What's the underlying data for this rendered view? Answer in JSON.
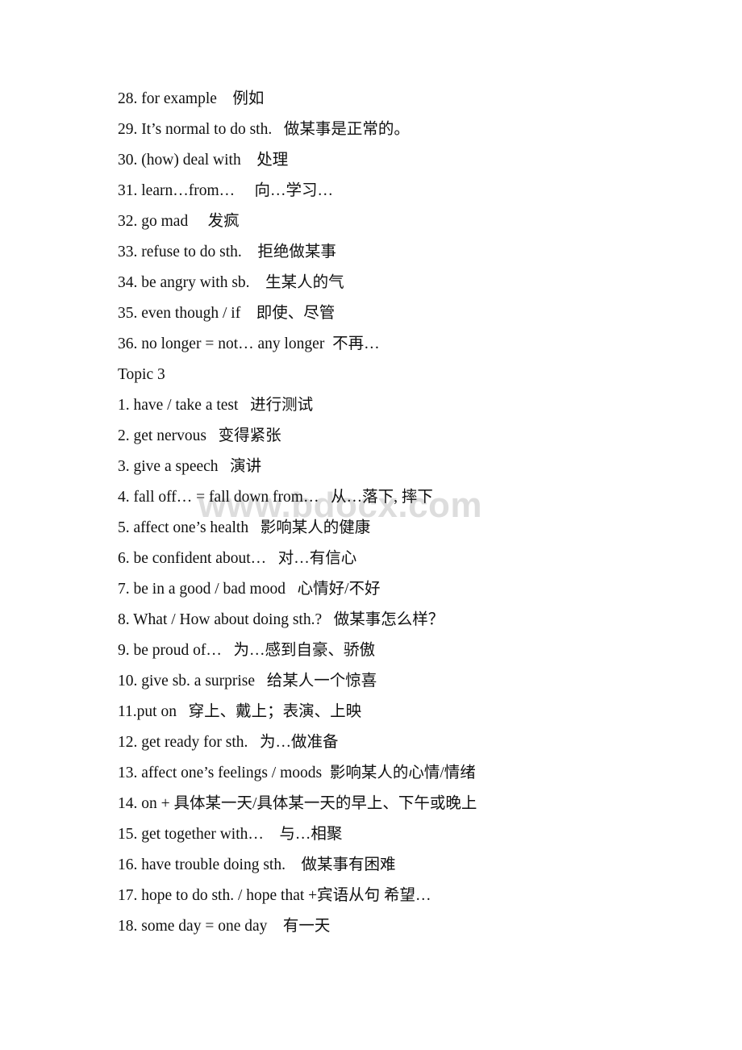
{
  "page": {
    "background_color": "#ffffff",
    "text_color": "#101010",
    "watermark": {
      "text": "www.bdocx.com",
      "color": "#dddddd"
    }
  },
  "blocks": [
    {
      "type": "list",
      "name": "topic-2-continued",
      "items": [
        {
          "num": "28.",
          "en": "for example",
          "gap": "    ",
          "cn": "例如"
        },
        {
          "num": "29.",
          "en": "It’s normal to do sth.",
          "gap": "   ",
          "cn": "做某事是正常的。"
        },
        {
          "num": "30.",
          "en": "(how) deal with",
          "gap": "    ",
          "cn": "处理"
        },
        {
          "num": "31.",
          "en": "learn…from…",
          "gap": "     ",
          "cn": "向…学习…"
        },
        {
          "num": "32.",
          "en": "go mad",
          "gap": "     ",
          "cn": "发疯"
        },
        {
          "num": "33.",
          "en": "refuse to do sth.",
          "gap": "    ",
          "cn": "拒绝做某事"
        },
        {
          "num": "34.",
          "en": "be angry with sb.",
          "gap": "    ",
          "cn": "生某人的气"
        },
        {
          "num": "35.",
          "en": "even though / if",
          "gap": "    ",
          "cn": "即使、尽管"
        },
        {
          "num": "36.",
          "en": "no longer = not… any longer",
          "gap": "  ",
          "cn": "不再…"
        }
      ]
    },
    {
      "type": "heading",
      "name": "topic-3-heading",
      "text": "Topic 3"
    },
    {
      "type": "list",
      "name": "topic-3-list",
      "items": [
        {
          "num": "1.",
          "en": "have / take a test",
          "gap": "   ",
          "cn": "进行测试"
        },
        {
          "num": "2.",
          "en": "get nervous",
          "gap": "   ",
          "cn": "变得紧张"
        },
        {
          "num": "3.",
          "en": "give a speech",
          "gap": "   ",
          "cn": "演讲"
        },
        {
          "num": "4.",
          "en": "fall off… = fall down from…",
          "gap": "   ",
          "cn": "从…落下, 摔下"
        },
        {
          "num": "5.",
          "en": "affect one’s health",
          "gap": "   ",
          "cn": "影响某人的健康"
        },
        {
          "num": "6.",
          "en": "be confident about…",
          "gap": "   ",
          "cn": "对…有信心"
        },
        {
          "num": "7.",
          "en": "be in a good / bad mood",
          "gap": "   ",
          "cn": "心情好/不好"
        },
        {
          "num": "8.",
          "en": "What / How about doing sth.?",
          "gap": "   ",
          "cn": "做某事怎么样？"
        },
        {
          "num": "9.",
          "en": "be proud of…",
          "gap": "   ",
          "cn": "为…感到自豪、骄傲"
        },
        {
          "num": "10.",
          "en": "give sb. a surprise",
          "gap": "   ",
          "cn": "给某人一个惊喜"
        },
        {
          "num": "11.",
          "en": "put on",
          "gap": "   ",
          "cn": "穿上、戴上；表演、上映",
          "no_space_after_num": true
        },
        {
          "num": "12.",
          "en": "get ready for sth.",
          "gap": "   ",
          "cn": "为…做准备"
        },
        {
          "num": "13.",
          "en": "affect one’s feelings / moods",
          "gap": "  ",
          "cn": "影响某人的心情/情绪"
        },
        {
          "num": "14.",
          "en": "on + 具体某一天/具体某一天的早上、下午或晚上",
          "gap": "",
          "cn": ""
        },
        {
          "num": "15.",
          "en": "get together with…",
          "gap": "    ",
          "cn": "与…相聚"
        },
        {
          "num": "16.",
          "en": "have trouble doing sth.",
          "gap": "    ",
          "cn": "做某事有困难"
        },
        {
          "num": "17.",
          "en": "hope to do sth. / hope that +宾语从句",
          "gap": " ",
          "cn": "希望…"
        },
        {
          "num": "18.",
          "en": "some day = one day",
          "gap": "    ",
          "cn": "有一天"
        }
      ]
    }
  ]
}
